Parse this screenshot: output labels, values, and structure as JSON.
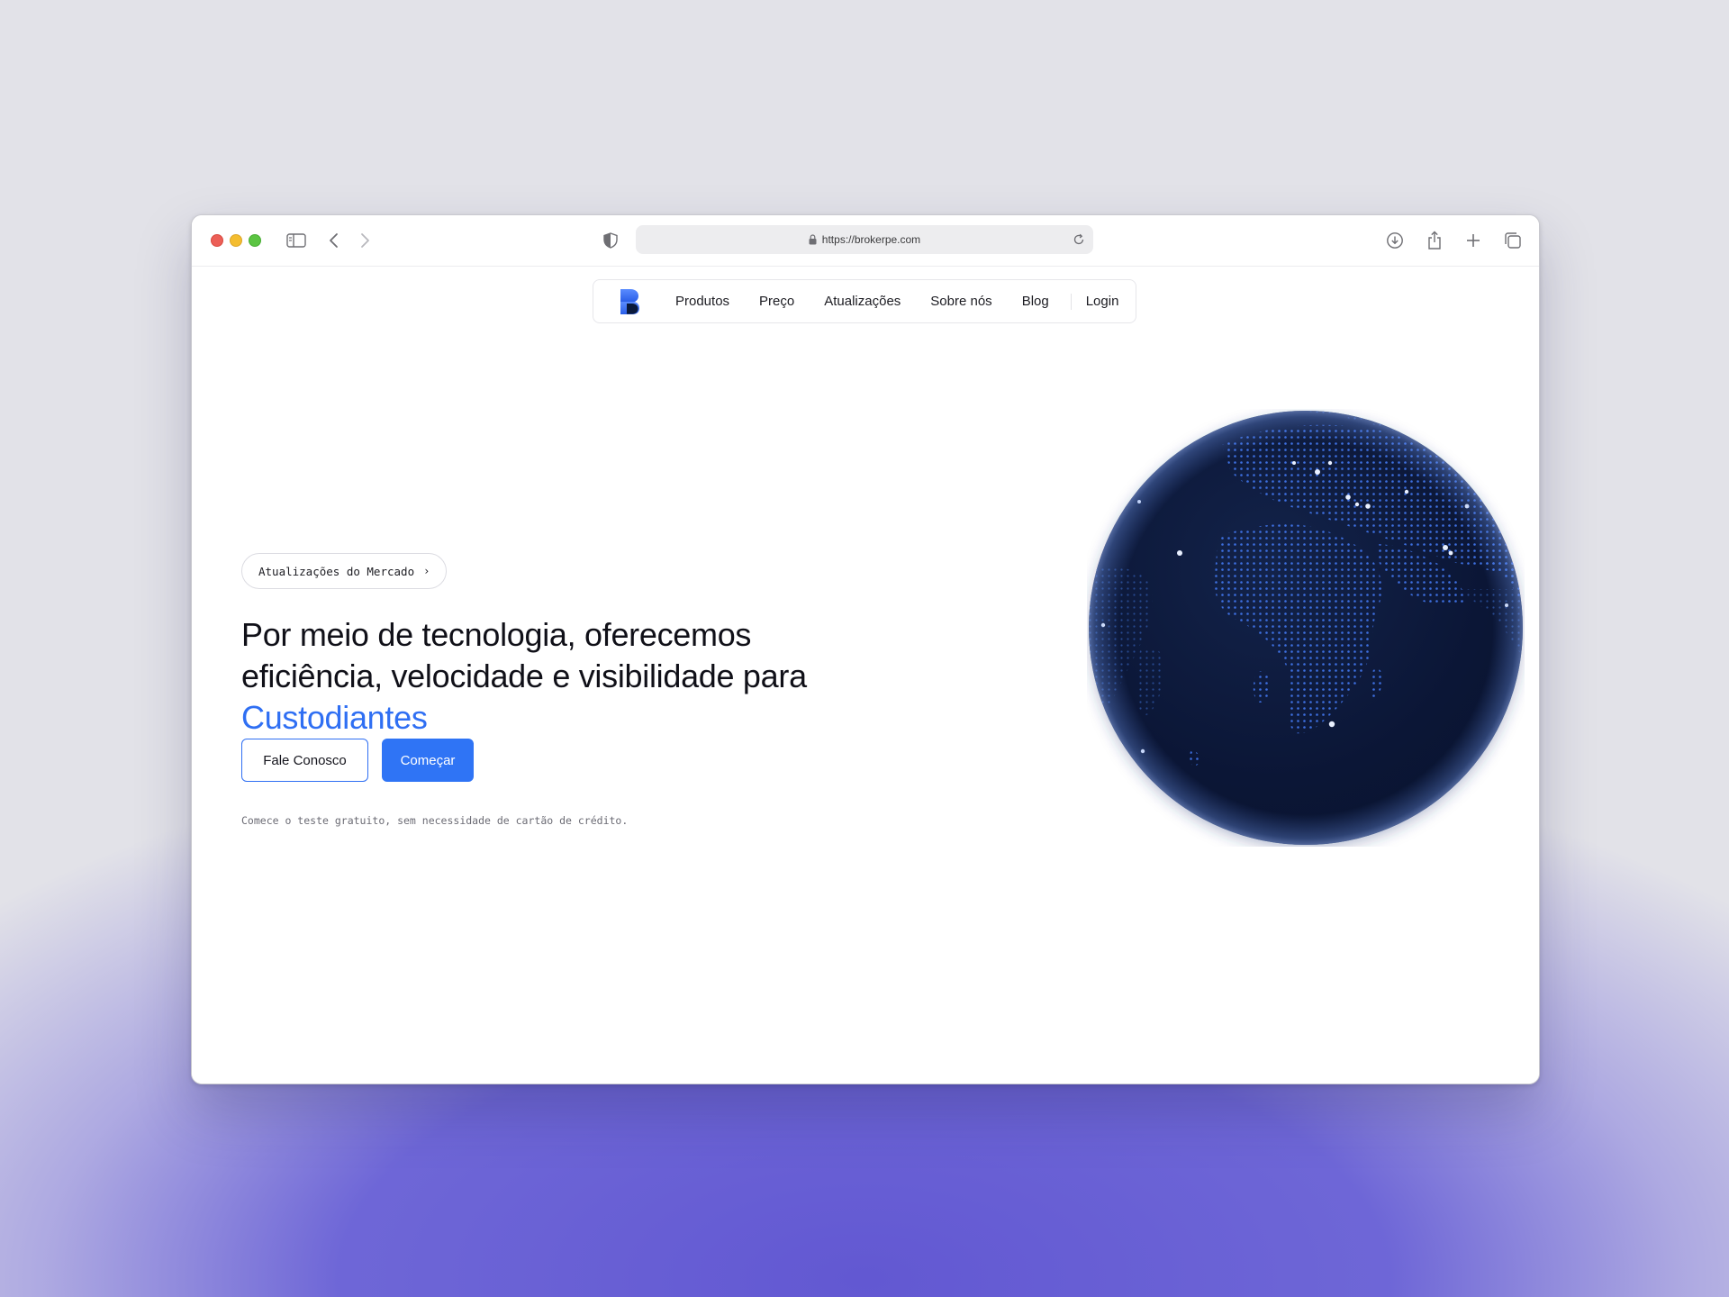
{
  "browser": {
    "url": "https://brokerpe.com"
  },
  "nav": {
    "links": [
      "Produtos",
      "Preço",
      "Atualizações",
      "Sobre nós",
      "Blog"
    ],
    "login": "Login"
  },
  "hero": {
    "badge": "Atualizações do Mercado",
    "headline_main": "Por meio de tecnologia, oferecemos eficiência, velocidade e visibilidade para ",
    "headline_accent": "Custodiantes",
    "contact_button": "Fale Conosco",
    "start_button": "Começar",
    "note": "Comece o teste gratuito, sem necessidade de cartão de crédito."
  },
  "colors": {
    "accent": "#2f6ff3",
    "globe": "#0c1838"
  },
  "icons": [
    "sidebar-icon",
    "back-icon",
    "forward-icon",
    "shield-icon",
    "lock-icon",
    "reload-icon",
    "download-icon",
    "share-icon",
    "new-tab-icon",
    "tabs-overview-icon",
    "chevron-right-icon"
  ]
}
